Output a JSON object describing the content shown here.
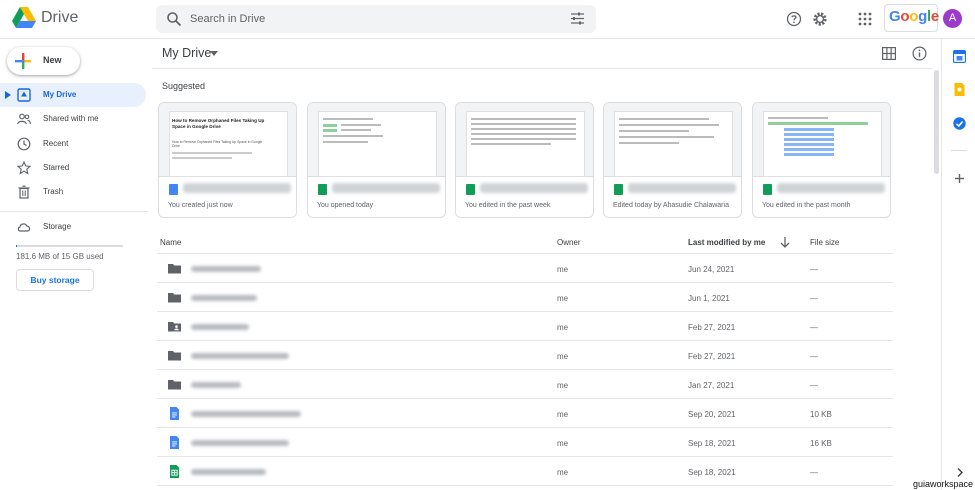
{
  "app": {
    "name": "Drive"
  },
  "search": {
    "placeholder": "Search in Drive"
  },
  "header": {
    "google_word": "Google",
    "avatar_letter": "A"
  },
  "sidebar": {
    "new_label": "New",
    "items": [
      {
        "label": "My Drive",
        "icon": "my-drive-icon",
        "active": true
      },
      {
        "label": "Shared with me",
        "icon": "people-icon"
      },
      {
        "label": "Recent",
        "icon": "clock-icon"
      },
      {
        "label": "Starred",
        "icon": "star-icon"
      },
      {
        "label": "Trash",
        "icon": "trash-icon"
      }
    ],
    "storage_label": "Storage",
    "storage_used_fraction": 0.01,
    "storage_text": "181.6 MB of 15 GB used",
    "buy_storage": "Buy storage"
  },
  "main": {
    "breadcrumb": "My Drive",
    "suggested_label": "Suggested",
    "cards": [
      {
        "type": "doc",
        "subtitle": "You created just now",
        "thumb_title": "How to Remove Orphaned Files Taking Up Space in Google Drive",
        "thumb_body": "How to Remove Orphaned Files Taking Up Space in Google Drive"
      },
      {
        "type": "sheet",
        "subtitle": "You opened today"
      },
      {
        "type": "sheet",
        "subtitle": "You edited in the past week"
      },
      {
        "type": "sheet",
        "subtitle": "Edited today by Ahasudie Chalawaria"
      },
      {
        "type": "sheet",
        "subtitle": "You edited in the past month"
      }
    ],
    "columns": {
      "name": "Name",
      "owner": "Owner",
      "modified": "Last modified by me",
      "size": "File size"
    },
    "rows": [
      {
        "type": "folder",
        "owner": "me",
        "modified": "Jun 24, 2021",
        "size": "—"
      },
      {
        "type": "folder",
        "owner": "me",
        "modified": "Jun 1, 2021",
        "size": "—"
      },
      {
        "type": "shared-folder",
        "owner": "me",
        "modified": "Feb 27, 2021",
        "size": "—"
      },
      {
        "type": "folder",
        "owner": "me",
        "modified": "Feb 27, 2021",
        "size": "—"
      },
      {
        "type": "folder",
        "owner": "me",
        "modified": "Jan 27, 2021",
        "size": "—"
      },
      {
        "type": "doc",
        "owner": "me",
        "modified": "Sep 20, 2021",
        "size": "10 KB"
      },
      {
        "type": "doc",
        "owner": "me",
        "modified": "Sep 18, 2021",
        "size": "16 KB"
      },
      {
        "type": "sheet",
        "owner": "me",
        "modified": "Sep 18, 2021",
        "size": "—"
      }
    ]
  },
  "watermark": "guiaworkspace"
}
